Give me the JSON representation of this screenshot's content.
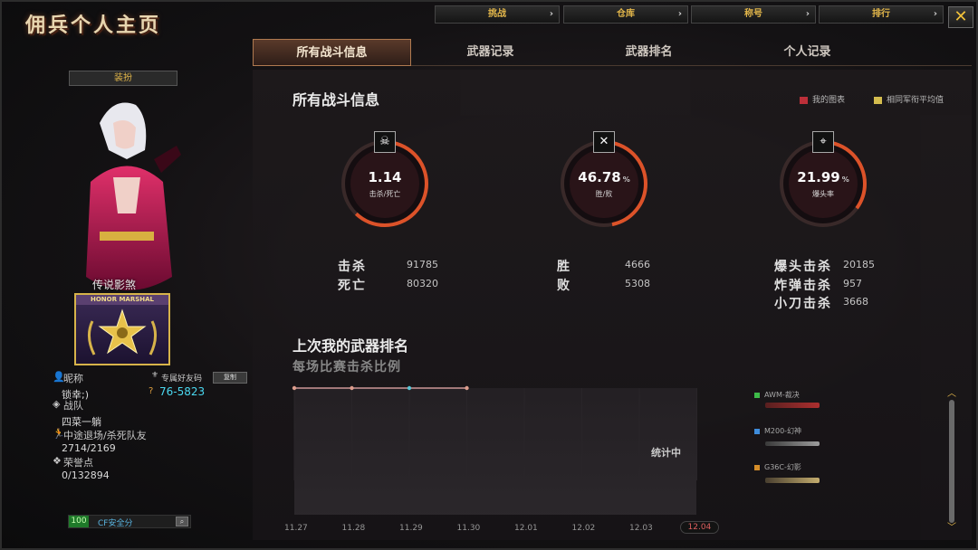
{
  "window": {
    "title": "佣兵个人主页"
  },
  "topnav": [
    {
      "label": "挑战"
    },
    {
      "label": "仓库"
    },
    {
      "label": "称号"
    },
    {
      "label": "排行"
    }
  ],
  "tabs": [
    {
      "label": "所有战斗信息",
      "active": true
    },
    {
      "label": "武器记录",
      "active": false
    },
    {
      "label": "武器排名",
      "active": false
    },
    {
      "label": "个人记录",
      "active": false
    }
  ],
  "profile": {
    "dressup_label": "装扮",
    "character_name": "传说影煞",
    "badge_text": "HONOR MARSHAL",
    "nickname_label": "昵称",
    "nickname": "锁幸;)",
    "friend_code_label": "专属好友码",
    "friend_code": "76-5823",
    "copy_label": "复制",
    "team_label": "战队",
    "team": "四菜一躺",
    "leave_kill_label": "中途退场/杀死队友",
    "leave_kill_value": "2714/2169",
    "honor_label": "荣誉点",
    "honor_value": "0/132894",
    "safety_score": "100",
    "safety_label": "CF安全分"
  },
  "battle": {
    "heading": "所有战斗信息",
    "legend": [
      {
        "label": "我的图表",
        "color": "#c0303a"
      },
      {
        "label": "相同军衔平均值",
        "color": "#d8c050"
      }
    ],
    "gauges": [
      {
        "value": "1.14",
        "unit": "",
        "label": "击杀/死亡",
        "icon": "skull-icon",
        "fraction": 0.62
      },
      {
        "value": "46.78",
        "unit": "%",
        "label": "胜/败",
        "icon": "crossed-guns-icon",
        "fraction": 0.4678
      },
      {
        "value": "21.99",
        "unit": "%",
        "label": "爆头率",
        "icon": "headshot-icon",
        "fraction": 0.35
      }
    ],
    "stats": {
      "kills_label": "击杀",
      "kills": "91785",
      "deaths_label": "死亡",
      "deaths": "80320",
      "wins_label": "胜",
      "wins": "4666",
      "losses_label": "败",
      "losses": "5308",
      "headshot_label": "爆头击杀",
      "headshot": "20185",
      "grenade_label": "炸弹击杀",
      "grenade": "957",
      "knife_label": "小刀击杀",
      "knife": "3668"
    }
  },
  "weapons": {
    "heading": "上次我的武器排名",
    "subheading": "每场比赛击杀比例",
    "overlay_label": "统计中",
    "items": [
      {
        "name": "AWM-裁决",
        "color": "#3fbf4a"
      },
      {
        "name": "M200-幻神",
        "color": "#3f8fdf"
      },
      {
        "name": "G36C-幻影",
        "color": "#d8902a"
      }
    ]
  },
  "chart_data": {
    "type": "line",
    "title": "每场比赛击杀比例",
    "categories": [
      "11.27",
      "11.28",
      "11.29",
      "11.30",
      "12.01",
      "12.02",
      "12.03",
      "12.04"
    ],
    "active_category": "12.04",
    "series": [
      {
        "name": "",
        "values": [
          0,
          0,
          0,
          0,
          null,
          null,
          null,
          null
        ]
      }
    ],
    "grid": true,
    "legend": "right"
  }
}
